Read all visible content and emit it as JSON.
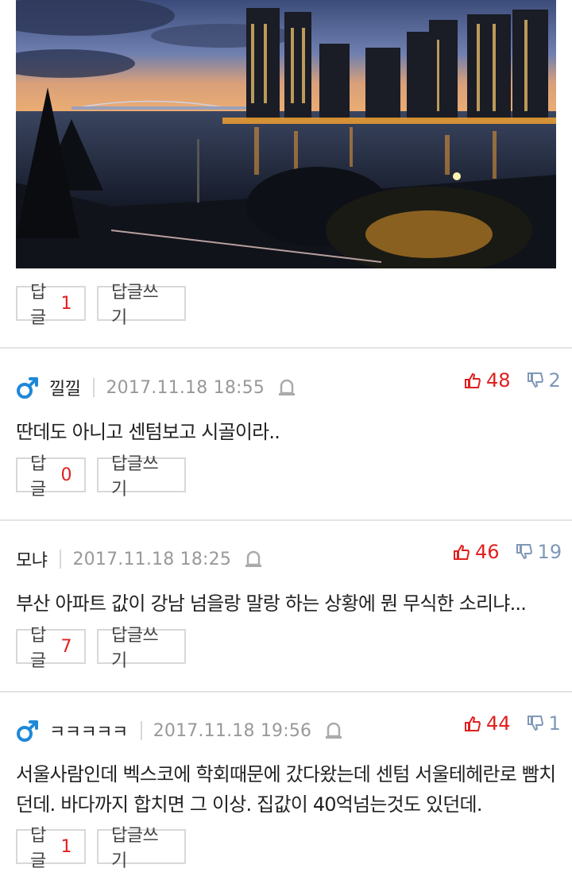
{
  "photo": {
    "alt": ""
  },
  "top_actions": {
    "reply_label": "답글",
    "reply_count": "1",
    "write_label": "답글쓰기"
  },
  "comments": [
    {
      "gender": "male",
      "nickname": "낄낄",
      "date": "2017.11.18 18:55",
      "likes": "48",
      "dislikes": "2",
      "text": "딴데도 아니고 센텀보고 시골이라..",
      "reply_label": "답글",
      "reply_count": "0",
      "write_label": "답글쓰기"
    },
    {
      "gender": "",
      "nickname": "모냐",
      "date": "2017.11.18 18:25",
      "likes": "46",
      "dislikes": "19",
      "text": "부산 아파트 값이 강남 넘을랑 말랑 하는 상황에 뭔 무식한 소리냐...",
      "reply_label": "답글",
      "reply_count": "7",
      "write_label": "답글쓰기"
    },
    {
      "gender": "male",
      "nickname": "ㅋㅋㅋㅋㅋ",
      "date": "2017.11.18 19:56",
      "likes": "44",
      "dislikes": "1",
      "text": "서울사람인데 벡스코에 학회때문에 갔다왔는데 센텀 서울테헤란로 빰치던데. 바다까지 합치면 그 이상. 집값이 40억넘는것도 있던데.",
      "reply_label": "답글",
      "reply_count": "1",
      "write_label": "답글쓰기"
    }
  ],
  "colors": {
    "accent_red": "#e02020",
    "dislike_blue": "#7f98b8",
    "male_blue": "#1e88d8"
  },
  "icons": [
    "male-icon",
    "bell-icon",
    "thumbs-up-icon",
    "thumbs-down-icon"
  ]
}
